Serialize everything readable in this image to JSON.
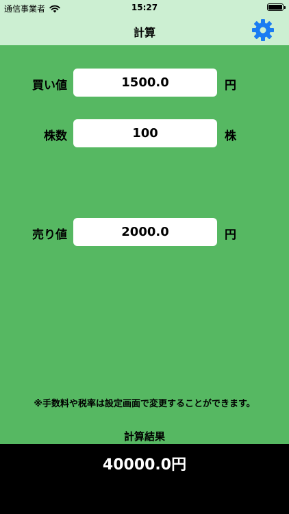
{
  "status_bar": {
    "carrier": "通信事業者",
    "time": "15:27"
  },
  "nav": {
    "title": "計算",
    "settings_icon": "gear-icon",
    "accent_color": "#1a7cf2"
  },
  "form": {
    "buy_price": {
      "label": "買い値",
      "value": "1500.0",
      "unit": "円"
    },
    "shares": {
      "label": "株数",
      "value": "100",
      "unit": "株"
    },
    "sell_price": {
      "label": "売り値",
      "value": "2000.0",
      "unit": "円"
    }
  },
  "note": "※手数料や税率は設定画面で変更することができます。",
  "result": {
    "label": "計算結果",
    "value": "40000.0円"
  },
  "colors": {
    "background": "#56b862",
    "header": "#ccefd2",
    "result_bar": "#000000"
  }
}
